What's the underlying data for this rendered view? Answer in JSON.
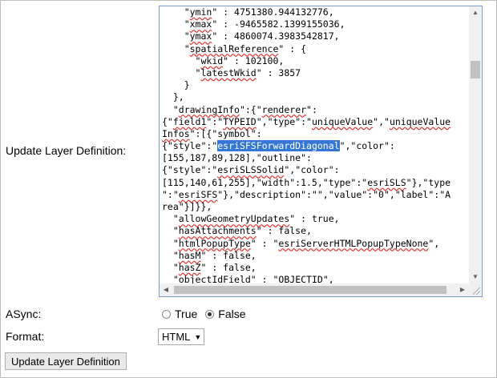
{
  "form": {
    "definition_label": "Update Layer Definition:",
    "async_label": "ASync:",
    "async_options": [
      {
        "label": "True",
        "checked": false
      },
      {
        "label": "False",
        "checked": true
      }
    ],
    "format_label": "Format:",
    "format_value": "HTML",
    "submit_label": "Update Layer Definition"
  },
  "editor": {
    "lines": [
      "    \"ymin\" : 4751380.944132776,",
      "    \"xmax\" : -9465582.1399155036,",
      "    \"ymax\" : 4860074.3983542817,",
      "    \"spatialReference\" : {",
      "      \"wkid\" : 102100,",
      "      \"latestWkid\" : 3857",
      "    }",
      "  },",
      "  \"drawingInfo\":{\"renderer\":",
      "{\"field1\":\"TYPEID\",\"type\":\"uniqueValue\",\"uniqueValue",
      "Infos\":[{\"symbol\":",
      "{\"style\":\"esriSFSForwardDiagonal\",\"color\":",
      "[155,187,89,128],\"outline\":",
      "{\"style\":\"esriSLSSolid\",\"color\":",
      "[115,140,61,255],\"width\":1.5,\"type\":\"esriSLS\"},\"type",
      "\":\"esriSFS\"},\"description\":\"\",\"value\":\"0\",\"label\":\"A",
      "rea\"}]}},",
      "  \"allowGeometryUpdates\" : true,",
      "  \"hasAttachments\" : false,",
      "  \"htmlPopupType\" : \"esriServerHTMLPopupTypeNone\",",
      "  \"hasM\" : false,",
      "  \"hasZ\" : false,",
      "  \"objectIdField\" : \"OBJECTID\","
    ],
    "selected_text": "esriSFSForwardDiagonal"
  },
  "colors": {
    "selection": "#3577d4",
    "editor_border": "#7a9ccc",
    "spell_underline": "#e03030"
  }
}
